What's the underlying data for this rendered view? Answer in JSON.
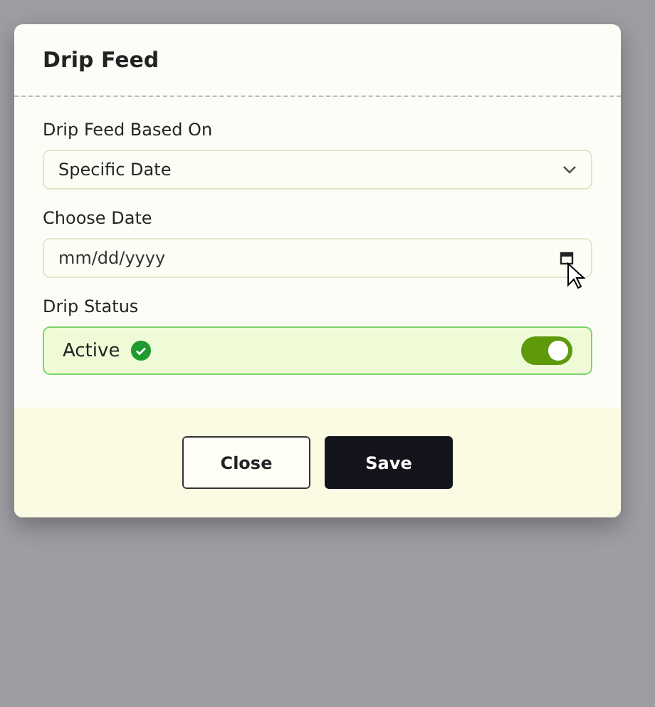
{
  "dialog": {
    "title": "Drip Feed",
    "fields": [
      {
        "kind": "select",
        "label": "Drip Feed Based On",
        "value": "Specific Date"
      },
      {
        "kind": "date",
        "label": "Choose Date",
        "placeholder": "mm/dd/yyyy"
      },
      {
        "kind": "toggle",
        "label": "Drip Status",
        "value": "Active",
        "on": true
      }
    ],
    "buttons": [
      {
        "label": "Close",
        "kind": "secondary"
      },
      {
        "label": "Save",
        "kind": "primary"
      }
    ]
  }
}
